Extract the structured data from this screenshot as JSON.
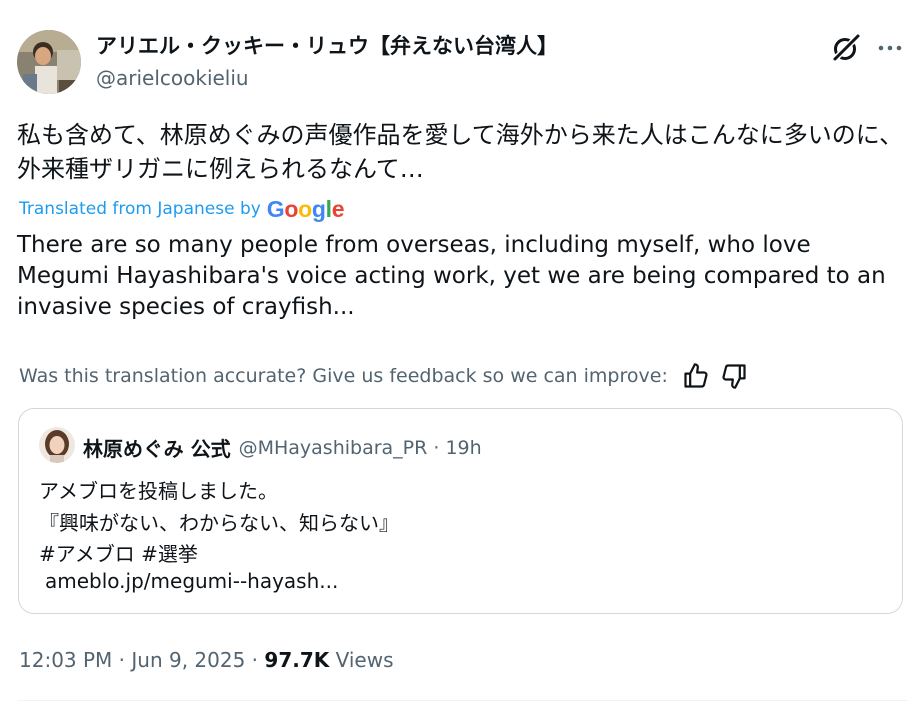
{
  "colors": {
    "text_primary": "#0f1419",
    "text_secondary": "#536471",
    "link_blue": "#1d9bf0",
    "border": "#cfd9de"
  },
  "author": {
    "display_name": "アリエル・クッキー・リュウ【弁えない台湾人】",
    "handle": "@arielcookieliu",
    "avatar": "avatar-photo"
  },
  "icons": {
    "grok": "grok-icon",
    "more": "more-options-icon",
    "like": "thumbs-up-icon",
    "dislike": "thumbs-down-icon"
  },
  "tweet": {
    "text_jp": "私も含めて、林原めぐみの声優作品を愛して海外から来た人はこんなに多いのに、外来種ザリガニに例えられるなんて…",
    "translated_label": "Translated from Japanese by",
    "google_letters": [
      "G",
      "o",
      "o",
      "g",
      "l",
      "e"
    ],
    "text_en": "There are so many people from overseas, including myself, who love Megumi Hayashibara's voice acting work, yet we are being compared to an invasive species of crayfish...",
    "feedback_prompt": "Was this translation accurate? Give us feedback so we can improve:"
  },
  "quote": {
    "name": "林原めぐみ 公式",
    "handle_time": "@MHayashibara_PR · 19h",
    "lines": [
      "アメブロを投稿しました。",
      "『興味がない、わからない、知らない』",
      "#アメブロ  #選挙"
    ],
    "link": "ameblo.jp/megumi--hayash..."
  },
  "footer": {
    "time_date": "12:03 PM · Jun 9, 2025 · ",
    "views_count": "97.7K",
    "views_label": " Views"
  }
}
